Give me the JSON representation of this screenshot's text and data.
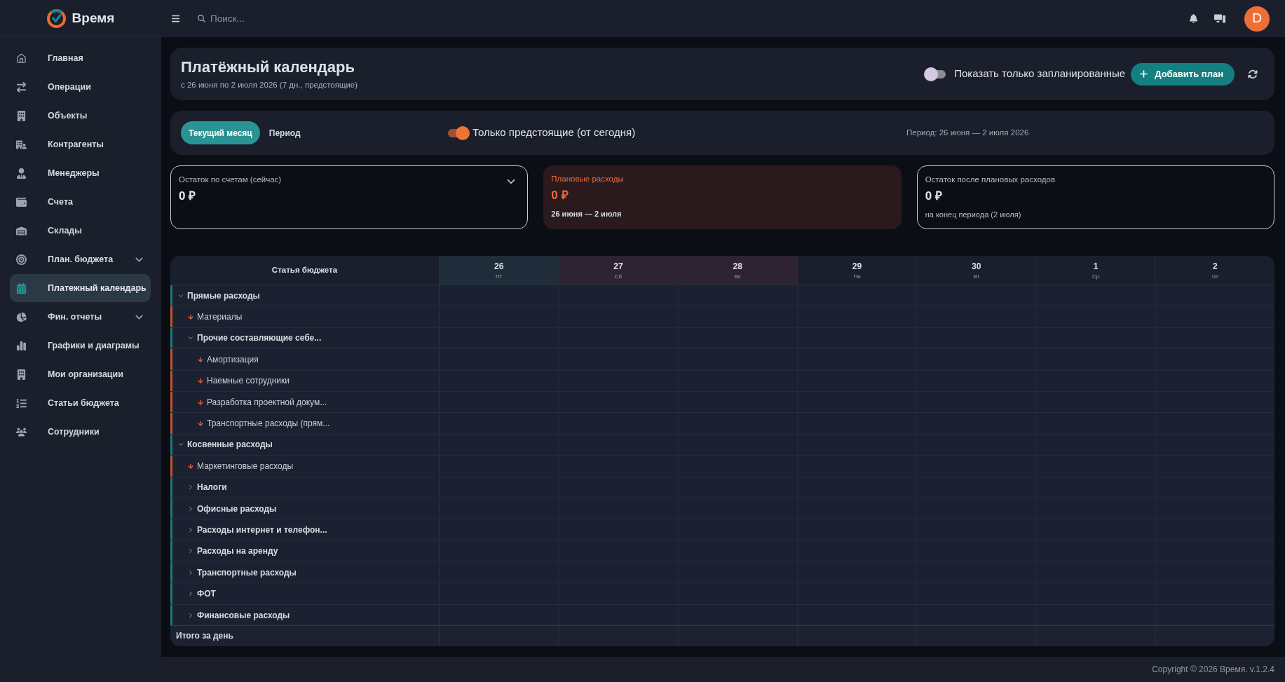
{
  "sidebar": {
    "logo": "Время",
    "items": [
      {
        "label": "Главная",
        "kind": "link",
        "selected": false
      },
      {
        "label": "Операции",
        "kind": "link",
        "selected": false
      },
      {
        "label": "Объекты",
        "kind": "link",
        "selected": false
      },
      {
        "label": "Контрагенты",
        "kind": "link",
        "selected": false
      },
      {
        "label": "Менеджеры",
        "kind": "link",
        "selected": false
      },
      {
        "label": "Счета",
        "kind": "link",
        "selected": false
      },
      {
        "label": "Склады",
        "kind": "link",
        "selected": false
      },
      {
        "label": "План. бюджета",
        "kind": "group",
        "selected": false
      },
      {
        "label": "Платежный календарь",
        "kind": "link",
        "selected": true
      },
      {
        "label": "Фин. отчеты",
        "kind": "group",
        "selected": false
      },
      {
        "label": "Графики и диаграмы",
        "kind": "link",
        "selected": false
      },
      {
        "label": "Мои организации",
        "kind": "link",
        "selected": false
      },
      {
        "label": "Статьи бюджета",
        "kind": "link",
        "selected": false
      },
      {
        "label": "Сотрудники",
        "kind": "link",
        "selected": false
      }
    ]
  },
  "top_bar": {
    "search": {
      "placeholder": "Поиск..."
    },
    "avatar": "D"
  },
  "header": {
    "title": "Платёжный календарь",
    "subtitle": "с 26 июня по 2 июля 2026 (7 дн., предстоящие)",
    "toggle": {
      "label": "Показать только запланированные",
      "on": false
    },
    "add_button": "Добавить план"
  },
  "filters": {
    "tabs": [
      {
        "label": "Текущий месяц",
        "selected": true
      },
      {
        "label": "Период",
        "selected": false
      }
    ],
    "toggle": {
      "label": "Только предстоящие (от сегодня)",
      "on": true
    },
    "period": "Период: 26 июня — 2 июля 2026"
  },
  "summary_cards": [
    {
      "kind": "dropdown",
      "label": "Остаток по счетам (сейчас)",
      "value": "0 ₽"
    },
    {
      "kind": "expense",
      "label": "Плановые расходы",
      "value": "0 ₽",
      "note": "26 июня — 2 июля"
    },
    {
      "kind": "plain",
      "label": "Остаток после плановых расходов",
      "value": "0 ₽",
      "note": "на конец периода (2 июля)"
    }
  ],
  "table": {
    "category_header": "Статья бюджета",
    "days": [
      {
        "day": "26",
        "weekday": "Пт",
        "kind": "today"
      },
      {
        "day": "27",
        "weekday": "Сб",
        "kind": "weekend"
      },
      {
        "day": "28",
        "weekday": "Вс",
        "kind": "weekend"
      },
      {
        "day": "29",
        "weekday": "Пн",
        "kind": "workday"
      },
      {
        "day": "30",
        "weekday": "Вт",
        "kind": "workday"
      },
      {
        "day": "1",
        "weekday": "Ср",
        "kind": "workday"
      },
      {
        "day": "2",
        "weekday": "Чт",
        "kind": "workday"
      }
    ],
    "rows": [
      {
        "label": "Прямые расходы",
        "kind": "group",
        "expanded": true,
        "children": [
          {
            "label": "Материалы",
            "kind": "item"
          },
          {
            "label": "Прочие составляющие себе...",
            "kind": "group",
            "expanded": true,
            "children": [
              {
                "label": "Амортизация",
                "kind": "item"
              },
              {
                "label": "Наемные сотрудники",
                "kind": "item"
              },
              {
                "label": "Разработка проектной докум...",
                "kind": "item"
              },
              {
                "label": "Транспортные расходы (прям...",
                "kind": "item"
              }
            ]
          }
        ]
      },
      {
        "label": "Косвенные расходы",
        "kind": "group",
        "expanded": true,
        "children": [
          {
            "label": "Маркетинговые расходы",
            "kind": "item"
          },
          {
            "label": "Налоги",
            "kind": "group",
            "expanded": false
          },
          {
            "label": "Офисные расходы",
            "kind": "group",
            "expanded": false
          },
          {
            "label": "Расходы интернет и телефон...",
            "kind": "group",
            "expanded": false
          },
          {
            "label": "Расходы на аренду",
            "kind": "group",
            "expanded": false
          },
          {
            "label": "Транспортные расходы",
            "kind": "group",
            "expanded": false
          },
          {
            "label": "ФОТ",
            "kind": "group",
            "expanded": false
          },
          {
            "label": "Финансовые расходы",
            "kind": "group",
            "expanded": false
          }
        ]
      }
    ],
    "total_label": "Итого за день"
  },
  "footer": "Copyright © 2026 Время. v.1.2.4"
}
